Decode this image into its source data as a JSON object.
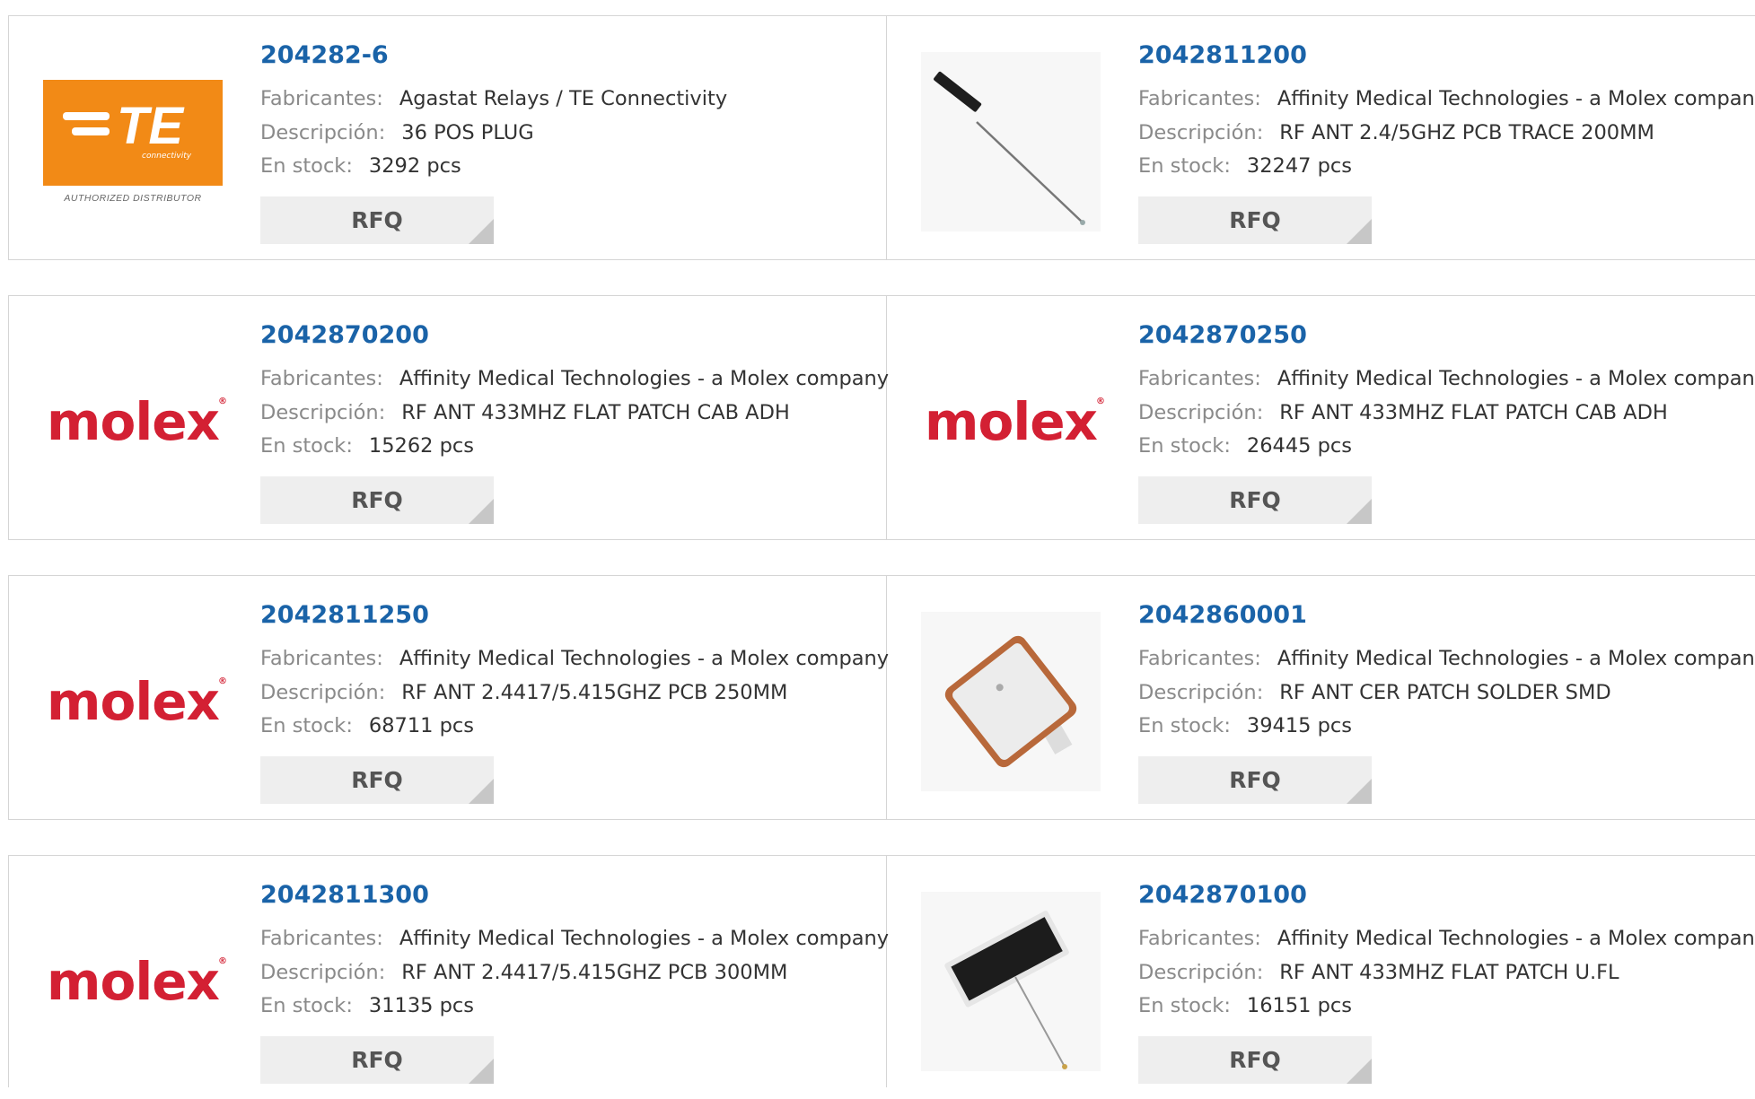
{
  "labels": {
    "manufacturer": "Fabricantes:",
    "description": "Descripción:",
    "stock": "En stock:",
    "rfq": "RFQ"
  },
  "te_logo": {
    "brand": "TE",
    "sub": "connectivity",
    "tagline": "AUTHORIZED DISTRIBUTOR"
  },
  "molex_logo": {
    "brand": "molex"
  },
  "products": [
    {
      "pn": "204282-6",
      "manufacturer": "Agastat Relays / TE Connectivity",
      "description": "36 POS PLUG",
      "stock": "3292 pcs",
      "image": "te-logo"
    },
    {
      "pn": "2042811200",
      "manufacturer": "Affinity Medical Technologies - a Molex company",
      "description": "RF ANT 2.4/5GHZ PCB TRACE 200MM",
      "stock": "32247 pcs",
      "image": "trace-antenna-photo"
    },
    {
      "pn": "2042870200",
      "manufacturer": "Affinity Medical Technologies - a Molex company",
      "description": "RF ANT 433MHZ FLAT PATCH CAB ADH",
      "stock": "15262 pcs",
      "image": "molex-logo"
    },
    {
      "pn": "2042870250",
      "manufacturer": "Affinity Medical Technologies - a Molex company",
      "description": "RF ANT 433MHZ FLAT PATCH CAB ADH",
      "stock": "26445 pcs",
      "image": "molex-logo"
    },
    {
      "pn": "2042811250",
      "manufacturer": "Affinity Medical Technologies - a Molex company",
      "description": "RF ANT 2.4417/5.415GHZ PCB 250MM",
      "stock": "68711 pcs",
      "image": "molex-logo"
    },
    {
      "pn": "2042860001",
      "manufacturer": "Affinity Medical Technologies - a Molex company",
      "description": "RF ANT CER PATCH SOLDER SMD",
      "stock": "39415 pcs",
      "image": "ceramic-patch-photo"
    },
    {
      "pn": "2042811300",
      "manufacturer": "Affinity Medical Technologies - a Molex company",
      "description": "RF ANT 2.4417/5.415GHZ PCB 300MM",
      "stock": "31135 pcs",
      "image": "molex-logo"
    },
    {
      "pn": "2042870100",
      "manufacturer": "Affinity Medical Technologies - a Molex company",
      "description": "RF ANT 433MHZ FLAT PATCH U.FL",
      "stock": "16151 pcs",
      "image": "flat-patch-photo"
    }
  ]
}
